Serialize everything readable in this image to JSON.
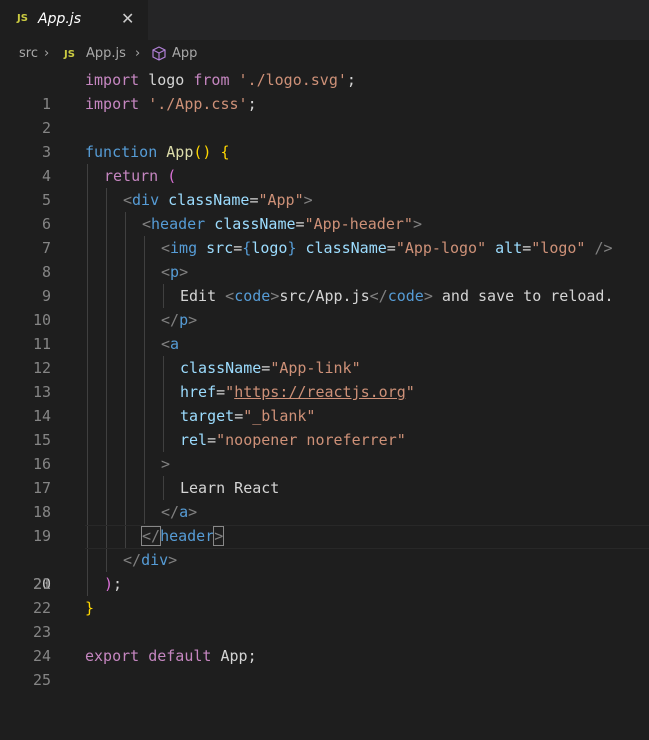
{
  "tab": {
    "badge": "JS",
    "title": "App.js",
    "close": "✕"
  },
  "breadcrumb": {
    "folder": "src",
    "file_badge": "JS",
    "file": "App.js",
    "symbol": "App"
  },
  "editor": {
    "active_line": 20,
    "lines": [
      {
        "n": "1"
      },
      {
        "n": "2"
      },
      {
        "n": "3"
      },
      {
        "n": "4"
      },
      {
        "n": "5"
      },
      {
        "n": "6"
      },
      {
        "n": "7"
      },
      {
        "n": "8"
      },
      {
        "n": "9"
      },
      {
        "n": "10"
      },
      {
        "n": "11"
      },
      {
        "n": "12"
      },
      {
        "n": "13"
      },
      {
        "n": "14"
      },
      {
        "n": "15"
      },
      {
        "n": "16"
      },
      {
        "n": "17"
      },
      {
        "n": "18"
      },
      {
        "n": "19"
      },
      {
        "n": "20"
      },
      {
        "n": "21"
      },
      {
        "n": "22"
      },
      {
        "n": "23"
      },
      {
        "n": "24"
      },
      {
        "n": "25"
      }
    ],
    "tokens": {
      "l1": [
        "import",
        " logo ",
        "from",
        " ",
        "'./logo.svg'",
        ";"
      ],
      "l2": [
        "import",
        " ",
        "'./App.css'",
        ";"
      ],
      "l4": [
        "function",
        " ",
        "App",
        "()",
        " ",
        "{"
      ],
      "l5": [
        "return",
        " ",
        "("
      ],
      "l6": [
        "<",
        "div",
        " ",
        "className",
        "=",
        "\"App\"",
        ">"
      ],
      "l7": [
        "<",
        "header",
        " ",
        "className",
        "=",
        "\"App-header\"",
        ">"
      ],
      "l8": [
        "<",
        "img",
        " ",
        "src",
        "=",
        "{",
        "logo",
        "}",
        " ",
        "className",
        "=",
        "\"App-logo\"",
        " ",
        "alt",
        "=",
        "\"logo\"",
        " />"
      ],
      "l9": [
        "<",
        "p",
        ">"
      ],
      "l10": [
        "Edit ",
        "<",
        "code",
        ">",
        "src/App.js",
        "</",
        "code",
        ">",
        " and save to reload."
      ],
      "l11": [
        "</",
        "p",
        ">"
      ],
      "l12": [
        "<",
        "a"
      ],
      "l13": [
        "className",
        "=",
        "\"App-link\""
      ],
      "l14": [
        "href",
        "=",
        "\"",
        "https://reactjs.org",
        "\""
      ],
      "l15": [
        "target",
        "=",
        "\"_blank\""
      ],
      "l16": [
        "rel",
        "=",
        "\"noopener noreferrer\""
      ],
      "l17": [
        ">"
      ],
      "l18": [
        "Learn React"
      ],
      "l19": [
        "</",
        "a",
        ">"
      ],
      "l20": [
        "</",
        "header",
        ">"
      ],
      "l21": [
        "</",
        "div",
        ">"
      ],
      "l22": [
        ")",
        ";"
      ],
      "l23": [
        "}"
      ],
      "l25": [
        "export",
        " ",
        "default",
        " ",
        "App",
        ";"
      ]
    }
  }
}
